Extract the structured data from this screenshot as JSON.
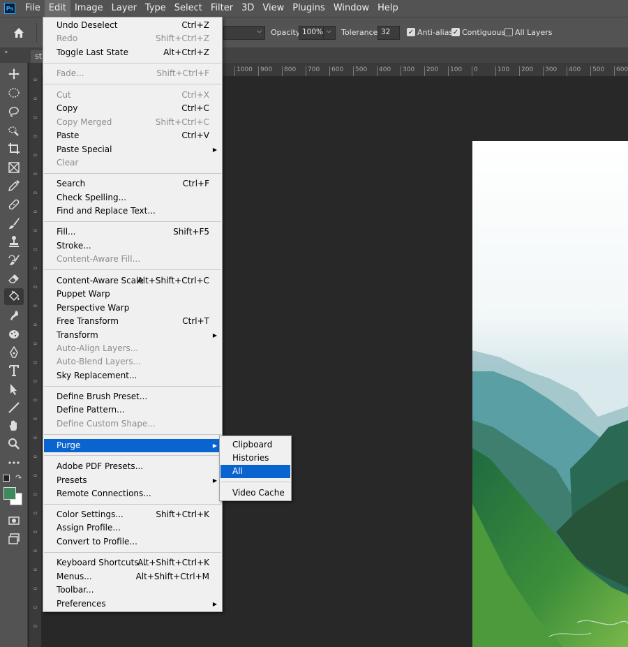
{
  "menubar": {
    "logo": "Ps",
    "items": [
      "File",
      "Edit",
      "Image",
      "Layer",
      "Type",
      "Select",
      "Filter",
      "3D",
      "View",
      "Plugins",
      "Window",
      "Help"
    ]
  },
  "options": {
    "opacity_label": "Opacity:",
    "opacity_value": "100%",
    "tolerance_label": "Tolerance:",
    "tolerance_value": "32",
    "antialias_label": "Anti-alias",
    "antialias_checked": true,
    "contiguous_label": "Contiguous",
    "contiguous_checked": true,
    "all_layers_label": "All Layers",
    "all_layers_checked": false
  },
  "document_tab": "st",
  "rulers": {
    "horizontal": [
      "1000",
      "900",
      "800",
      "700",
      "600",
      "500",
      "400",
      "300",
      "200",
      "100",
      "0",
      "100",
      "200",
      "300",
      "400",
      "500",
      "600"
    ],
    "vertical": [
      "0",
      "0",
      "0",
      "0",
      "0",
      "0",
      "0",
      "0",
      "0",
      "0",
      "0",
      "0",
      "0",
      "0",
      "0",
      "0",
      "0",
      "0",
      "0",
      "0",
      "0",
      "0",
      "0",
      "0",
      "0",
      "0",
      "0",
      "0",
      "0",
      "0"
    ]
  },
  "edit_menu": {
    "items": [
      {
        "label": "Undo Deselect",
        "shortcut": "Ctrl+Z",
        "disabled": false
      },
      {
        "label": "Redo",
        "shortcut": "Shift+Ctrl+Z",
        "disabled": true
      },
      {
        "label": "Toggle Last State",
        "shortcut": "Alt+Ctrl+Z",
        "disabled": false
      },
      {
        "label": "Fade...",
        "shortcut": "Shift+Ctrl+F",
        "disabled": true
      },
      {
        "label": "Cut",
        "shortcut": "Ctrl+X",
        "disabled": true
      },
      {
        "label": "Copy",
        "shortcut": "Ctrl+C",
        "disabled": false
      },
      {
        "label": "Copy Merged",
        "shortcut": "Shift+Ctrl+C",
        "disabled": true
      },
      {
        "label": "Paste",
        "shortcut": "Ctrl+V",
        "disabled": false
      },
      {
        "label": "Paste Special",
        "shortcut": "",
        "disabled": false,
        "submenu": true
      },
      {
        "label": "Clear",
        "shortcut": "",
        "disabled": true
      },
      {
        "label": "Search",
        "shortcut": "Ctrl+F",
        "disabled": false
      },
      {
        "label": "Check Spelling...",
        "shortcut": "",
        "disabled": false
      },
      {
        "label": "Find and Replace Text...",
        "shortcut": "",
        "disabled": false
      },
      {
        "label": "Fill...",
        "shortcut": "Shift+F5",
        "disabled": false
      },
      {
        "label": "Stroke...",
        "shortcut": "",
        "disabled": false
      },
      {
        "label": "Content-Aware Fill...",
        "shortcut": "",
        "disabled": true
      },
      {
        "label": "Content-Aware Scale",
        "shortcut": "Alt+Shift+Ctrl+C",
        "disabled": false
      },
      {
        "label": "Puppet Warp",
        "shortcut": "",
        "disabled": false
      },
      {
        "label": "Perspective Warp",
        "shortcut": "",
        "disabled": false
      },
      {
        "label": "Free Transform",
        "shortcut": "Ctrl+T",
        "disabled": false
      },
      {
        "label": "Transform",
        "shortcut": "",
        "disabled": false,
        "submenu": true
      },
      {
        "label": "Auto-Align Layers...",
        "shortcut": "",
        "disabled": true
      },
      {
        "label": "Auto-Blend Layers...",
        "shortcut": "",
        "disabled": true
      },
      {
        "label": "Sky Replacement...",
        "shortcut": "",
        "disabled": false
      },
      {
        "label": "Define Brush Preset...",
        "shortcut": "",
        "disabled": false
      },
      {
        "label": "Define Pattern...",
        "shortcut": "",
        "disabled": false
      },
      {
        "label": "Define Custom Shape...",
        "shortcut": "",
        "disabled": true
      },
      {
        "label": "Purge",
        "shortcut": "",
        "disabled": false,
        "submenu": true,
        "selected": true
      },
      {
        "label": "Adobe PDF Presets...",
        "shortcut": "",
        "disabled": false
      },
      {
        "label": "Presets",
        "shortcut": "",
        "disabled": false,
        "submenu": true
      },
      {
        "label": "Remote Connections...",
        "shortcut": "",
        "disabled": false
      },
      {
        "label": "Color Settings...",
        "shortcut": "Shift+Ctrl+K",
        "disabled": false
      },
      {
        "label": "Assign Profile...",
        "shortcut": "",
        "disabled": false
      },
      {
        "label": "Convert to Profile...",
        "shortcut": "",
        "disabled": false
      },
      {
        "label": "Keyboard Shortcuts...",
        "shortcut": "Alt+Shift+Ctrl+K",
        "disabled": false
      },
      {
        "label": "Menus...",
        "shortcut": "Alt+Shift+Ctrl+M",
        "disabled": false
      },
      {
        "label": "Toolbar...",
        "shortcut": "",
        "disabled": false
      },
      {
        "label": "Preferences",
        "shortcut": "",
        "disabled": false,
        "submenu": true
      }
    ]
  },
  "purge_submenu": {
    "items": [
      {
        "label": "Clipboard",
        "selected": false
      },
      {
        "label": "Histories",
        "selected": false
      },
      {
        "label": "All",
        "selected": true
      },
      {
        "label": "Video Cache",
        "selected": false
      }
    ]
  },
  "tools": [
    "move-icon",
    "marquee-icon",
    "lasso-icon",
    "quick-select-icon",
    "crop-icon",
    "frame-icon",
    "eyedropper-icon",
    "healing-icon",
    "brush-icon",
    "stamp-icon",
    "history-brush-icon",
    "eraser-icon",
    "paint-bucket-icon",
    "blur-icon",
    "dodge-icon",
    "pen-icon",
    "type-icon",
    "path-select-icon",
    "line-icon",
    "hand-icon",
    "zoom-icon",
    "more-tools-icon"
  ],
  "colors": {
    "foreground": "#3e8a5a",
    "background": "#ffffff",
    "menu_highlight": "#0a64d0"
  }
}
